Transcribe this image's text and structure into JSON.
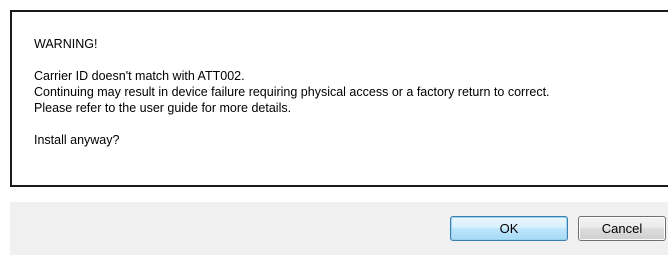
{
  "dialog": {
    "heading": "WARNING!",
    "lines": [
      "Carrier ID doesn't match with ATT002.",
      "Continuing may result in device failure requiring physical access or a factory return to correct.",
      "Please refer to the user guide for more details."
    ],
    "question": "Install anyway?"
  },
  "buttons": {
    "ok_label": "OK",
    "cancel_label": "Cancel"
  }
}
